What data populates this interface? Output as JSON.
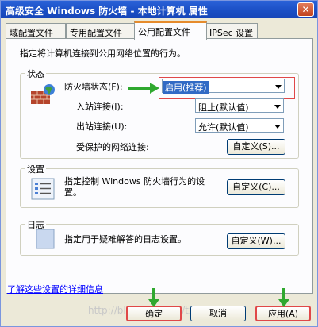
{
  "window": {
    "title": "高级安全 Windows 防火墙 - 本地计算机 属性",
    "close_label": "✕"
  },
  "tabs": [
    {
      "label": "域配置文件"
    },
    {
      "label": "专用配置文件"
    },
    {
      "label": "公用配置文件"
    },
    {
      "label": "IPSec 设置"
    }
  ],
  "description": "指定将计算机连接到公用网络位置的行为。",
  "state_group": {
    "label": "状态",
    "firewall_state_label": "防火墙状态(F):",
    "firewall_state_value": "启用(推荐)",
    "inbound_label": "入站连接(I):",
    "inbound_value": "阻止(默认值)",
    "outbound_label": "出站连接(U):",
    "outbound_value": "允许(默认值)",
    "protected_label": "受保护的网络连接:",
    "protected_button": "自定义(S)..."
  },
  "settings_group": {
    "label": "设置",
    "text": "指定控制 Windows 防火墙行为的设置。",
    "button": "自定义(C)..."
  },
  "log_group": {
    "label": "日志",
    "text": "指定用于疑难解答的日志设置。",
    "button": "自定义(W)..."
  },
  "learn_more_link": "了解这些设置的详细信息",
  "footer": {
    "ok": "确定",
    "cancel": "取消",
    "apply": "应用(A)"
  },
  "watermark": "http://blog.csdn.net/tx"
}
